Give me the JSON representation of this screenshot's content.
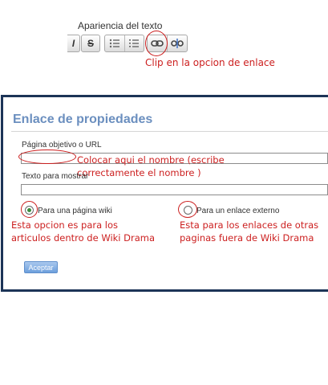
{
  "toolbar": {
    "caption": "Apariencia del texto",
    "buttons": {
      "italic_label": "I",
      "strike_label": "S"
    },
    "annotation": "Clip en la opcion de enlace"
  },
  "dialog": {
    "title": "Enlace de propiedades",
    "target_label": "Página objetivo o URL",
    "target_value": "",
    "text_label": "Texto para mostrar",
    "text_value": "",
    "radio_wiki_label": "Para una página wiki",
    "radio_external_label": "Para un enlace externo",
    "accept_label": "Aceptar",
    "annotations": {
      "name": [
        "Colocar aqui el nombre (escribe",
        "correctamente el nombre )"
      ],
      "wiki": [
        "Esta opcion es para los",
        "articulos dentro de Wiki Drama"
      ],
      "external": [
        "Esta para los enlaces de otras",
        "paginas fuera de Wiki Drama"
      ]
    }
  },
  "colors": {
    "title": "#6b8fbf",
    "dialog_border": "#1c3457",
    "annotation": "#cc1f1f",
    "accept_button": "#6d9fdc"
  },
  "icons": [
    "list-bullet-icon",
    "list-numbered-icon",
    "link-icon",
    "unlink-icon"
  ]
}
